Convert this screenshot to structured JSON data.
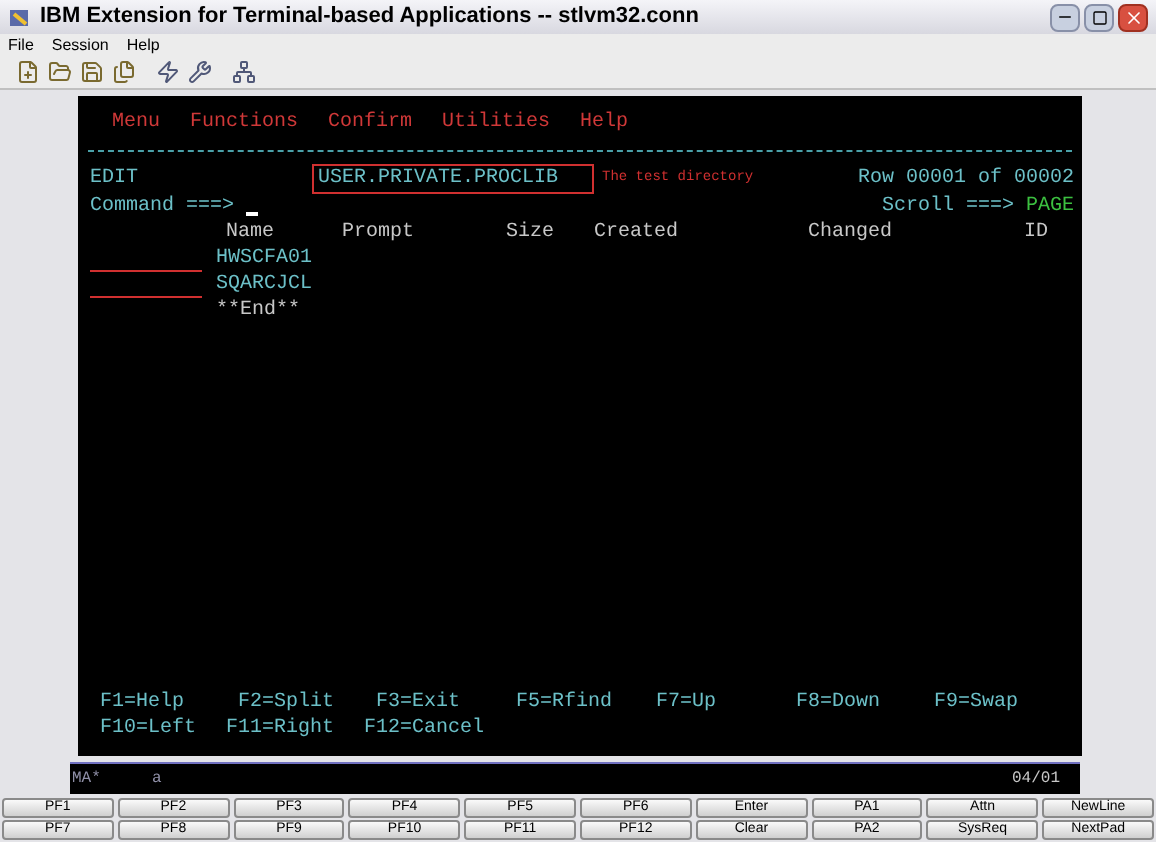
{
  "window": {
    "title": "IBM Extension for Terminal-based Applications -- stlvm32.conn"
  },
  "menu": [
    "File",
    "Session",
    "Help"
  ],
  "terminal": {
    "action_bar": [
      "Menu",
      "Functions",
      "Confirm",
      "Utilities",
      "Help"
    ],
    "mode": "EDIT",
    "dataset": "USER.PRIVATE.PROCLIB",
    "annotation": "The test directory",
    "row_info": "Row 00001 of 00002",
    "command_label": "Command ===>",
    "scroll_label": "Scroll ===>",
    "scroll_value": "PAGE",
    "columns": [
      "Name",
      "Prompt",
      "Size",
      "Created",
      "Changed",
      "ID"
    ],
    "members": [
      "HWSCFA01",
      "SQARCJCL"
    ],
    "end_marker": "**End**",
    "function_keys": [
      [
        "F1=Help",
        "F2=Split",
        "F3=Exit",
        "F5=Rfind",
        "F7=Up",
        "F8=Down",
        "F9=Swap"
      ],
      [
        "F10=Left",
        "F11=Right",
        "F12=Cancel"
      ]
    ]
  },
  "status_line": {
    "left": "MA*",
    "middle": "a",
    "right": "04/01"
  },
  "buttons": [
    [
      "PF1",
      "PF2",
      "PF3",
      "PF4",
      "PF5",
      "PF6",
      "Enter",
      "PA1",
      "Attn",
      "NewLine"
    ],
    [
      "PF7",
      "PF8",
      "PF9",
      "PF10",
      "PF11",
      "PF12",
      "Clear",
      "PA2",
      "SysReq",
      "NextPad"
    ]
  ]
}
